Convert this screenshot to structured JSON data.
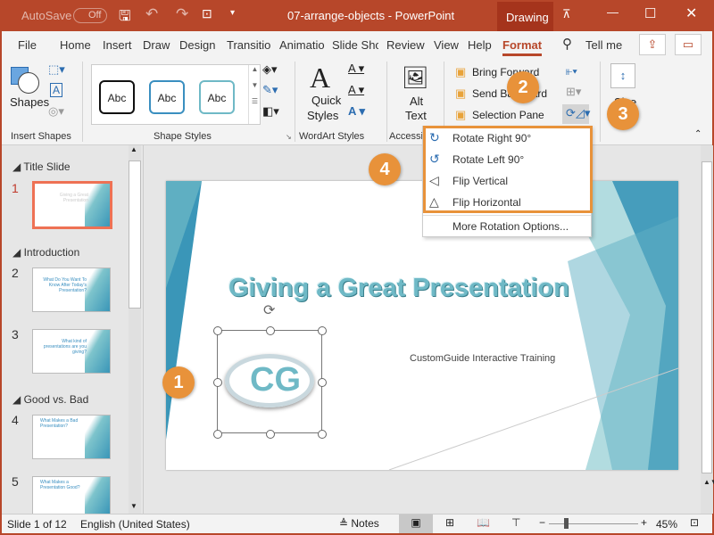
{
  "titlebar": {
    "autosave": "AutoSave",
    "autosave_state": "Off",
    "title": "07-arrange-objects  -  PowerPoint",
    "context_tab": "Drawing"
  },
  "tabs": [
    "File",
    "Home",
    "Insert",
    "Draw",
    "Design",
    "Transitio",
    "Animatio",
    "Slide Sho",
    "Review",
    "View",
    "Help",
    "Format"
  ],
  "active_tab": "Format",
  "tell_me": "Tell me",
  "ribbon": {
    "shapes": "Shapes",
    "insert_shapes": "Insert Shapes",
    "abc": "Abc",
    "shape_styles": "Shape Styles",
    "quick_styles": "Quick",
    "quick_styles2": "Styles",
    "wordart_styles": "WordArt Styles",
    "alt_text": "Alt",
    "alt_text2": "Text",
    "accessibility": "Accessibility",
    "bring_forward": "Bring Forward",
    "send_backward": "Send Backward",
    "selection_pane": "Selection Pane",
    "size": "Size"
  },
  "rotate_menu": [
    {
      "label": "Rotate Right 90°",
      "icon": "rotate-right-icon"
    },
    {
      "label": "Rotate Left 90°",
      "icon": "rotate-left-icon"
    },
    {
      "label": "Flip Vertical",
      "icon": "flip-vertical-icon"
    },
    {
      "label": "Flip Horizontal",
      "icon": "flip-horizontal-icon"
    },
    {
      "label": "More Rotation Options..."
    }
  ],
  "callouts": [
    "1",
    "2",
    "3",
    "4"
  ],
  "sections": [
    "Title Slide",
    "Introduction",
    "Good vs. Bad"
  ],
  "slides": [
    {
      "num": "1",
      "text": "Giving a Great Presentation"
    },
    {
      "num": "2",
      "text": "What Do You Want To Know After Today's Presentation?"
    },
    {
      "num": "3",
      "text": "What kind of presentations are you giving?"
    },
    {
      "num": "4",
      "text": "What Makes a Bad Presentation?"
    },
    {
      "num": "5",
      "text": "What Makes a Presentation Good?"
    }
  ],
  "slide": {
    "title": "Giving a Great Presentation",
    "subtitle": "CustomGuide Interactive Training",
    "logo": "CG"
  },
  "status": {
    "slide": "Slide 1 of 12",
    "language": "English (United States)",
    "notes": "Notes",
    "zoom": "45%",
    "zoom_level": 45
  },
  "colors": {
    "accent": "#b7472a",
    "callout": "#e8923a",
    "slide_title": "#6fb9c6"
  }
}
